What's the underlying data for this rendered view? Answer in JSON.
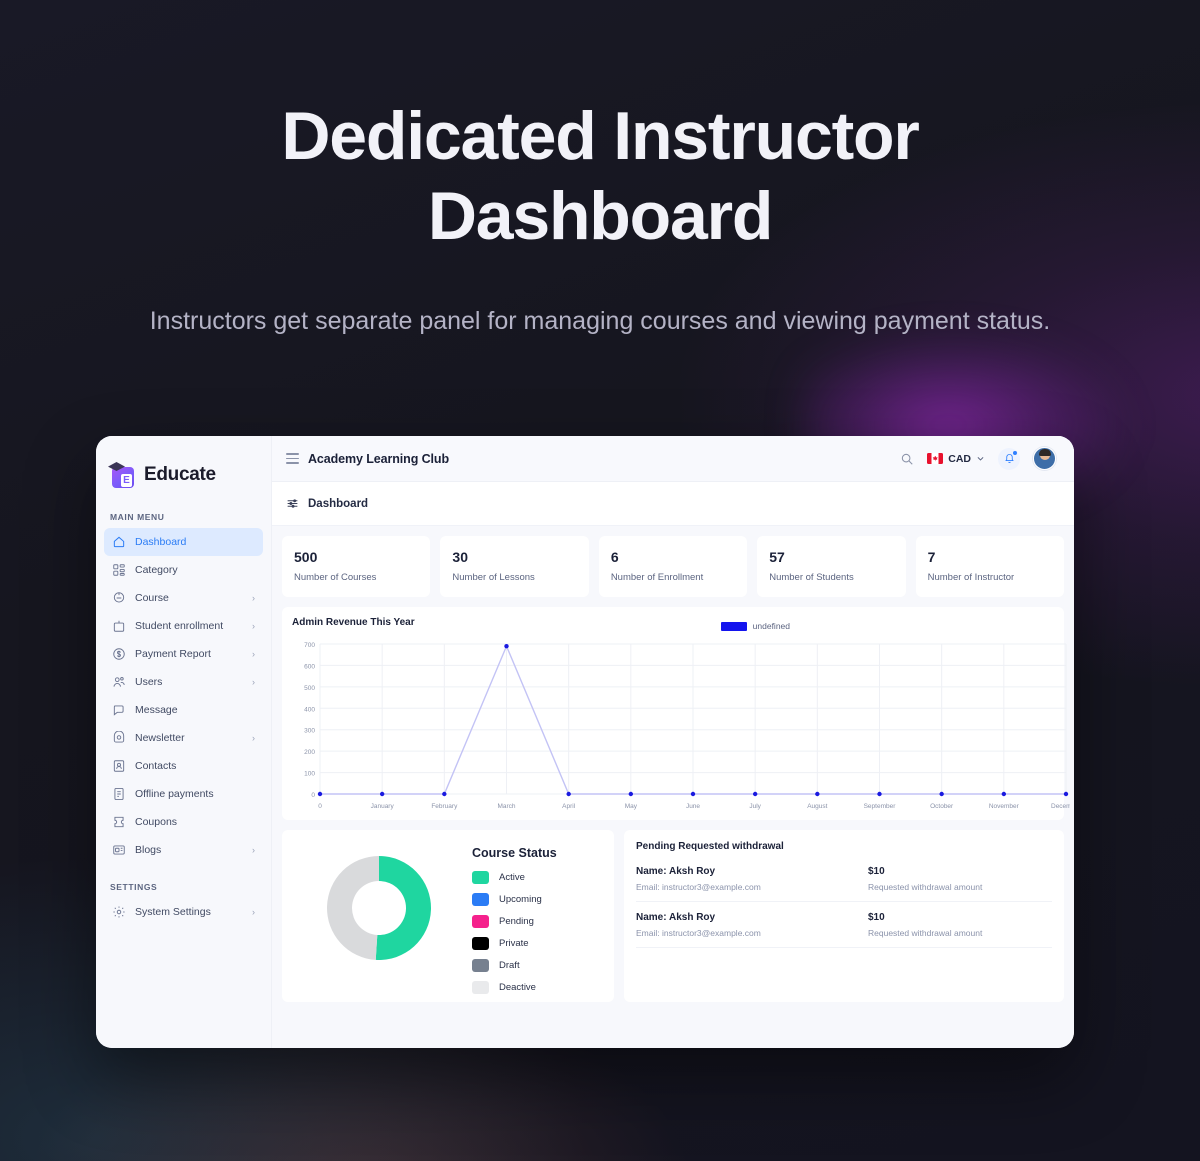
{
  "hero": {
    "title_line1": "Dedicated Instructor",
    "title_line2": "Dashboard",
    "subtitle": "Instructors get separate panel for managing courses and viewing payment status."
  },
  "brand": {
    "name": "Educate"
  },
  "sidebar": {
    "main_menu_label": "MAIN MENU",
    "settings_label": "SETTINGS",
    "items": [
      {
        "label": "Dashboard",
        "icon": "home-icon",
        "active": true,
        "chevron": false
      },
      {
        "label": "Category",
        "icon": "category-icon",
        "active": false,
        "chevron": false
      },
      {
        "label": "Course",
        "icon": "course-icon",
        "active": false,
        "chevron": true
      },
      {
        "label": "Student enrollment",
        "icon": "student-enrollment-icon",
        "active": false,
        "chevron": true
      },
      {
        "label": "Payment Report",
        "icon": "payment-report-icon",
        "active": false,
        "chevron": true
      },
      {
        "label": "Users",
        "icon": "users-icon",
        "active": false,
        "chevron": true
      },
      {
        "label": "Message",
        "icon": "message-icon",
        "active": false,
        "chevron": false
      },
      {
        "label": "Newsletter",
        "icon": "newsletter-icon",
        "active": false,
        "chevron": true
      },
      {
        "label": "Contacts",
        "icon": "contacts-icon",
        "active": false,
        "chevron": false
      },
      {
        "label": "Offline payments",
        "icon": "offline-payments-icon",
        "active": false,
        "chevron": false
      },
      {
        "label": "Coupons",
        "icon": "coupons-icon",
        "active": false,
        "chevron": false
      },
      {
        "label": "Blogs",
        "icon": "blogs-icon",
        "active": false,
        "chevron": true
      }
    ],
    "settings_items": [
      {
        "label": "System Settings",
        "icon": "gear-icon",
        "active": false,
        "chevron": true
      }
    ]
  },
  "topbar": {
    "title": "Academy Learning Club",
    "currency": "CAD",
    "search_icon": "search-icon",
    "bell_icon": "bell-icon",
    "avatar": "avatar"
  },
  "breadcrumb": {
    "label": "Dashboard"
  },
  "stats": [
    {
      "value": "500",
      "label": "Number of Courses"
    },
    {
      "value": "30",
      "label": "Number of Lessons"
    },
    {
      "value": "6",
      "label": "Number of Enrollment"
    },
    {
      "value": "57",
      "label": "Number of Students"
    },
    {
      "value": "7",
      "label": "Number of Instructor"
    }
  ],
  "chart_data": {
    "type": "line",
    "title": "Admin Revenue This Year",
    "legend": [
      {
        "name": "undefined",
        "color": "#1414ee"
      }
    ],
    "legend_position": "top-right",
    "grid": true,
    "xlabel": "",
    "ylabel": "",
    "categories": [
      "0",
      "January",
      "February",
      "March",
      "April",
      "May",
      "June",
      "July",
      "August",
      "September",
      "October",
      "November",
      "December"
    ],
    "values": [
      0,
      0,
      0,
      690,
      0,
      0,
      0,
      0,
      0,
      0,
      0,
      0,
      0
    ],
    "ylim": [
      0,
      700
    ],
    "yticks": [
      0,
      100,
      200,
      300,
      400,
      500,
      600,
      700
    ],
    "line_color": "#c3c3f5",
    "point_color": "#1a1ae0"
  },
  "course_status": {
    "title": "Course Status",
    "type": "donut",
    "legend": [
      {
        "label": "Active",
        "color": "#1fd6a0"
      },
      {
        "label": "Upcoming",
        "color": "#2b7cf5"
      },
      {
        "label": "Pending",
        "color": "#f5218c"
      },
      {
        "label": "Private",
        "color": "#000000"
      },
      {
        "label": "Draft",
        "color": "#76808f"
      },
      {
        "label": "Deactive",
        "color": "#e9eaec"
      }
    ],
    "slices": [
      {
        "label": "Active",
        "value": 51,
        "color": "#1fd6a0"
      },
      {
        "label": "Deactive",
        "value": 49,
        "color": "#d9dadc"
      }
    ]
  },
  "withdrawals": {
    "title": "Pending Requested withdrawal",
    "amount_caption": "Requested withdrawal amount",
    "rows": [
      {
        "name": "Name: Aksh Roy",
        "email": "Email: instructor3@example.com",
        "amount": "$10",
        "caption": "Requested withdrawal amount"
      },
      {
        "name": "Name: Aksh Roy",
        "email": "Email: instructor3@example.com",
        "amount": "$10",
        "caption": "Requested withdrawal amount"
      }
    ]
  }
}
